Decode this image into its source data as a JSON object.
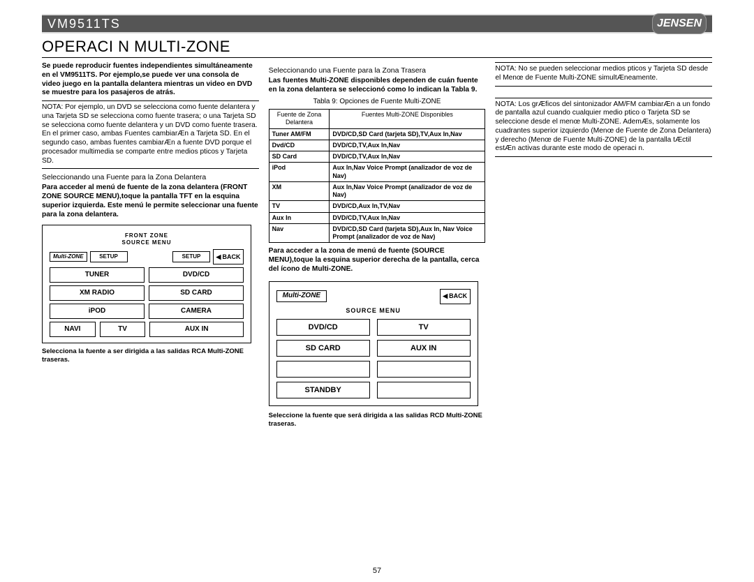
{
  "header": {
    "model": "VM9511TS",
    "brand": "JENSEN"
  },
  "title": "OPERACI N MULTI-ZONE",
  "page_number": "57",
  "col1": {
    "intro": "Se puede reproducir fuentes independientes simultáneamente en el VM9511TS. Por ejemplo,se puede ver una consola de video juego en la pantalla delantera mientras un video en DVD se muestre para los pasajeros de atrás.",
    "note": "NOTA: Por ejemplo, un DVD se selecciona como fuente delantera y una Tarjeta SD se selecciona como fuente trasera; o una Tarjeta SD se selecciona como fuente delantera y un DVD como fuente trasera.  En el primer caso, ambas Fuentes cambiarÆn a Tarjeta SD. En el segundo caso, ambas fuentes cambiarÆn a fuente DVD porque el procesador multimedia se comparte entre medios  pticos y Tarjeta SD.",
    "subhead": "Seleccionando una Fuente para la Zona Delantera",
    "front_access": "Para acceder al menú de fuente de la zona delantera (FRONT ZONE SOURCE MENU),toque la pantalla TFT en la esquina superior izquierda. Este menú le permite seleccionar una fuente para la zona delantera.",
    "front_menu_title1": "FRONT ZONE",
    "front_menu_title2": "SOURCE MENU",
    "back": "BACK",
    "mz_tab": "Multi-ZONE",
    "setup": "SETUP",
    "btn_tuner": "TUNER",
    "btn_dvdcd": "DVD/CD",
    "btn_xm": "XM RADIO",
    "btn_sd": "SD CARD",
    "btn_ipod": "iPOD",
    "btn_cam": "CAMERA",
    "btn_navi": "NAVI",
    "btn_tv": "TV",
    "btn_aux": "AUX IN",
    "front_caption": "Selecciona la fuente a ser dirigida a las salidas RCA Multi-ZONE traseras."
  },
  "col2": {
    "subhead": "Seleccionando una Fuente para la Zona Trasera",
    "rear_intro": "Las fuentes Multi-ZONE disponibles dependen de cuán fuente en la zona delantera se seleccionó como lo indican la Tabla 9.",
    "table_caption": "Tabla 9: Opciones de Fuente Multi-ZONE",
    "th_left": "Fuente de Zona Delantera",
    "th_right": "Fuentes Multi-ZONE Disponibles",
    "rows": [
      [
        "Tuner AM/FM",
        "DVD/CD,SD Card (tarjeta SD),TV,Aux In,Nav"
      ],
      [
        "Dvd/CD",
        "DVD/CD,TV,Aux In,Nav"
      ],
      [
        "SD Card",
        "DVD/CD,TV,Aux In,Nav"
      ],
      [
        "iPod",
        "Aux In,Nav Voice Prompt (analizador de voz de Nav)"
      ],
      [
        "XM",
        "Aux In,Nav Voice Prompt (analizador de voz de Nav)"
      ],
      [
        "TV",
        "DVD/CD,Aux In,TV,Nav"
      ],
      [
        "Aux In",
        "DVD/CD,TV,Aux In,Nav"
      ],
      [
        "Nav",
        "DVD/CD,SD Card (tarjeta SD),Aux In, Nav Voice Prompt (analizador de voz de Nav)"
      ]
    ],
    "rear_access": "Para acceder a la zona de menú de fuente (SOURCE MENU),toque la esquina superior derecha de la pantalla, cerca del ícono de Multi-ZONE.",
    "rear_mz": "Multi-ZONE",
    "rear_source": "SOURCE MENU",
    "r_dvdcd": "DVD/CD",
    "r_tv": "TV",
    "r_sd": "SD CARD",
    "r_aux": "AUX IN",
    "r_standby": "STANDBY",
    "rear_caption": "Seleccione la fuente que será dirigida a las salidas RCD Multi-ZONE traseras."
  },
  "col3": {
    "note1": "NOTA: No se pueden seleccionar medios  pticos y Tarjeta SD desde el Menœ de Fuente Multi-ZONE simultÆneamente.",
    "note2": "NOTA: Los grÆficos del sintonizador AM/FM cambiarÆn a un fondo de pantalla azul cuando cualquier medio  ptico o Tarjeta SD se seleccione desde el menœ Multi-ZONE. AdemÆs, solamente los cuadrantes superior izquierdo (Menœ de Fuente de Zona Delantera) y derecho (Menœ de Fuente Multi-ZONE) de la pantalla tÆctil estÆn activas durante este modo de operaci n."
  }
}
